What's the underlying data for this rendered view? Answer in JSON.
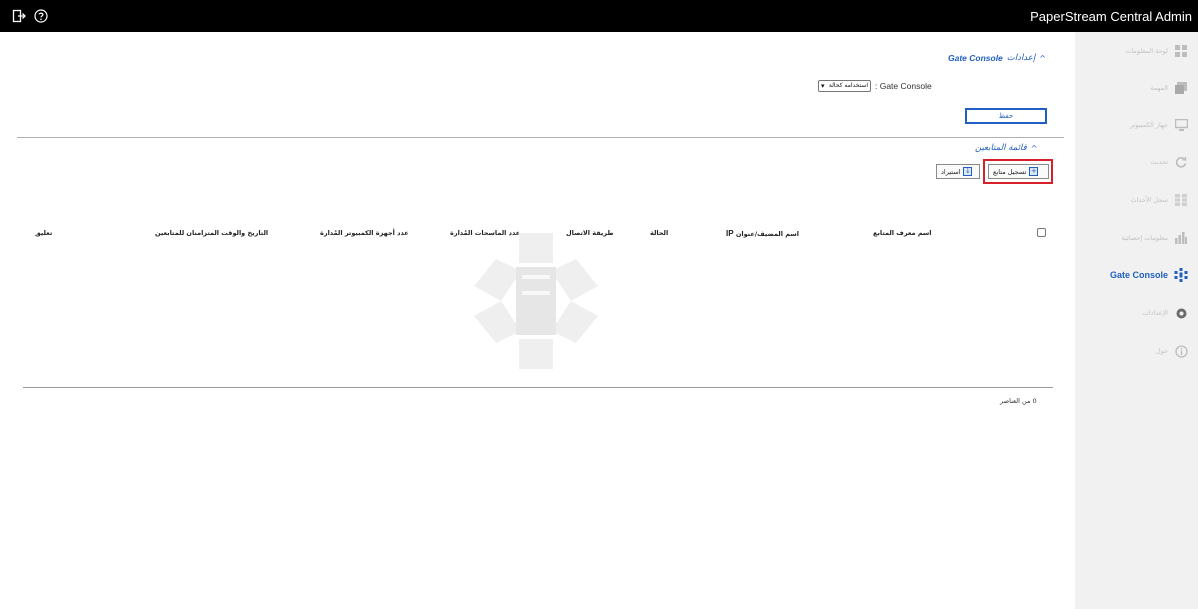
{
  "header": {
    "app_title": "PaperStream Central Admin",
    "logout_icon": "logout-icon",
    "help_icon": "help-circle-icon"
  },
  "sidebar": {
    "items": [
      {
        "label": "لوحة المعلومات",
        "icon": "dashboard-icon",
        "active": false
      },
      {
        "label": "المهمة",
        "icon": "task-icon",
        "active": false
      },
      {
        "label": "جهاز الكمبيوتر",
        "icon": "computer-icon",
        "active": false
      },
      {
        "label": "تحديث",
        "icon": "update-icon",
        "active": false
      },
      {
        "label": "سجل الأحداث",
        "icon": "event-log-icon",
        "active": false
      },
      {
        "label": "معلومات إحصائية",
        "icon": "statistics-icon",
        "active": false
      },
      {
        "label": "Gate Console",
        "icon": "gate-console-icon",
        "active": true
      },
      {
        "label": "الإعدادات",
        "icon": "settings-icon",
        "active": false
      },
      {
        "label": "حول",
        "icon": "about-icon",
        "active": false
      }
    ]
  },
  "settings_section": {
    "caret": "^",
    "title_prefix": "إعدادات",
    "title_bold": "Gate Console",
    "gc_label": ": Gate Console",
    "select_value": "استخدامه كحالة",
    "save_label": "حفظ"
  },
  "monitors_section": {
    "caret": "^",
    "title": "قائمة المتابعين",
    "register_label": "تسجيل متابع",
    "import_label": "استيراد",
    "columns": {
      "monitor_id": "اسم معرف المتابع",
      "host_ip_prefix": "اسم المضيف/عنوان",
      "host_ip_suffix": "IP",
      "status": "الحالة",
      "connection": "طريقة الاتصال",
      "managed_scanners": "عدد الماسحات المُدارة",
      "managed_computers": "عدد أجهزة الكمبيوتر المُدارة",
      "sync_datetime": "التاريخ والوقت المتزامنان للمتابعين",
      "comment": "تعليق"
    },
    "count_text": "0 من العناصر"
  },
  "colors": {
    "accent": "#1f5fbf",
    "highlight": "#d6202a",
    "header_bg": "#000000",
    "sidebar_bg": "#f1f1f1"
  }
}
